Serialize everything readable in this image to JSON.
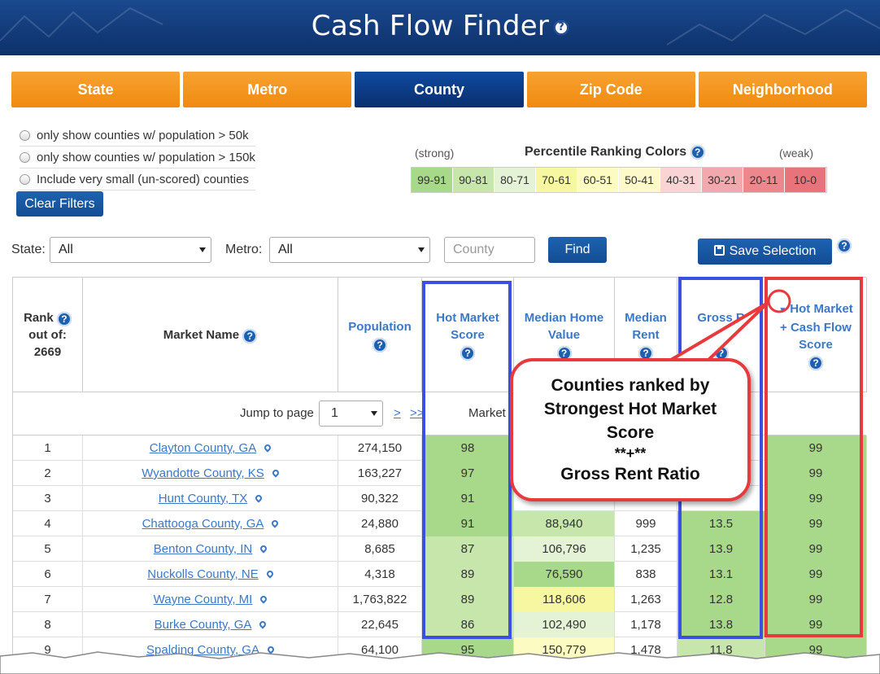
{
  "header": {
    "title": "Cash Flow Finder",
    "help": "?"
  },
  "tabs": [
    "State",
    "Metro",
    "County",
    "Zip Code",
    "Neighborhood"
  ],
  "filters": {
    "options": [
      "only show counties w/ population > 50k",
      "only show counties w/ population > 150k",
      "Include very small (un-scored) counties"
    ],
    "clear_label": "Clear Filters"
  },
  "legend": {
    "title": "Percentile Ranking Colors",
    "strong": "(strong)",
    "weak": "(weak)",
    "bins": [
      {
        "label": "99-91",
        "color": "#a8d88a"
      },
      {
        "label": "90-81",
        "color": "#c6e6ac"
      },
      {
        "label": "80-71",
        "color": "#e4f2d6"
      },
      {
        "label": "70-61",
        "color": "#f6f7a0"
      },
      {
        "label": "60-51",
        "color": "#fbfbc2"
      },
      {
        "label": "50-41",
        "color": "#fdf9c8"
      },
      {
        "label": "40-31",
        "color": "#f8d4d4"
      },
      {
        "label": "30-21",
        "color": "#f2a9ad"
      },
      {
        "label": "20-11",
        "color": "#ec878d"
      },
      {
        "label": "10-0",
        "color": "#e8737b"
      }
    ]
  },
  "search": {
    "state_label": "State:",
    "state_value": "All",
    "metro_label": "Metro:",
    "metro_value": "All",
    "county_placeholder": "County",
    "find_label": "Find",
    "save_label": "Save Selection"
  },
  "table": {
    "headers": {
      "rank": [
        "Rank",
        "out of:",
        "2669"
      ],
      "name": "Market Name",
      "population": "Population",
      "hot": [
        "Hot Market",
        "Score"
      ],
      "home": [
        "Median Home",
        "Value"
      ],
      "rent": [
        "Median",
        "Rent"
      ],
      "gross": [
        "Gross R"
      ],
      "hmcf": [
        "Hot Market",
        "+ Cash Flow",
        "Score"
      ]
    },
    "jump_label": "Jump to page",
    "page": "1",
    "next": ">",
    "last": ">>",
    "market_label": "Market",
    "rows": [
      {
        "rank": "1",
        "name": "Clayton County, GA",
        "pop": "274,150",
        "hot": "98",
        "home": "",
        "rent": "",
        "gross": "",
        "hmcf": "99"
      },
      {
        "rank": "2",
        "name": "Wyandotte County, KS",
        "pop": "163,227",
        "hot": "97",
        "home": "",
        "rent": "",
        "gross": "",
        "hmcf": "99"
      },
      {
        "rank": "3",
        "name": "Hunt County, TX",
        "pop": "90,322",
        "hot": "91",
        "home": "",
        "rent": "",
        "gross": "",
        "hmcf": "99"
      },
      {
        "rank": "4",
        "name": "Chattooga County, GA",
        "pop": "24,880",
        "hot": "91",
        "home": "88,940",
        "rent": "999",
        "gross": "13.5",
        "hmcf": "99"
      },
      {
        "rank": "5",
        "name": "Benton County, IN",
        "pop": "8,685",
        "hot": "87",
        "home": "106,796",
        "rent": "1,235",
        "gross": "13.9",
        "hmcf": "99"
      },
      {
        "rank": "6",
        "name": "Nuckolls County, NE",
        "pop": "4,318",
        "hot": "89",
        "home": "76,590",
        "rent": "838",
        "gross": "13.1",
        "hmcf": "99"
      },
      {
        "rank": "7",
        "name": "Wayne County, MI",
        "pop": "1,763,822",
        "hot": "89",
        "home": "118,606",
        "rent": "1,263",
        "gross": "12.8",
        "hmcf": "99"
      },
      {
        "rank": "8",
        "name": "Burke County, GA",
        "pop": "22,645",
        "hot": "86",
        "home": "102,490",
        "rent": "1,178",
        "gross": "13.8",
        "hmcf": "99"
      },
      {
        "rank": "9",
        "name": "Spalding County, GA",
        "pop": "64,100",
        "hot": "95",
        "home": "150,779",
        "rent": "1,478",
        "gross": "11.8",
        "hmcf": "99"
      }
    ]
  },
  "callout": {
    "lines": [
      "Counties ranked by",
      "Strongest Hot Market",
      "Score",
      "**+**",
      "Gross Rent Ratio"
    ]
  }
}
